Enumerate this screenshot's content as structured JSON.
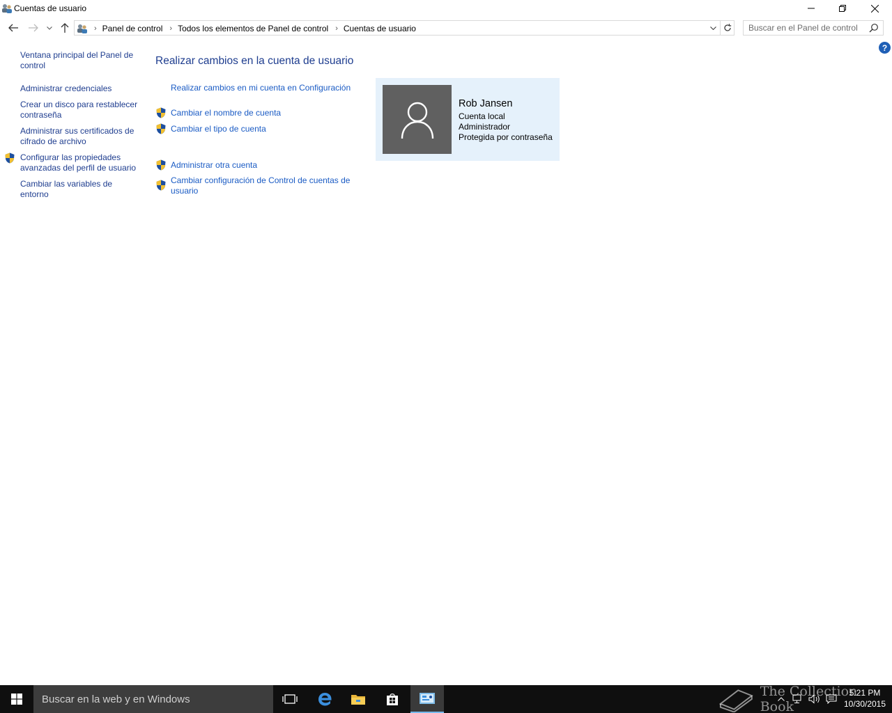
{
  "window": {
    "title": "Cuentas de usuario"
  },
  "breadcrumb": {
    "items": [
      "Panel de control",
      "Todos los elementos de Panel de control",
      "Cuentas de usuario"
    ]
  },
  "search": {
    "placeholder": "Buscar en el Panel de control"
  },
  "help": {
    "label": "?"
  },
  "left_pane": {
    "links": [
      "Ventana principal del Panel de control",
      "Administrar credenciales",
      "Crear un disco para restablecer contraseña",
      "Administrar sus certificados de cifrado de archivo",
      "Configurar las propiedades avanzadas del perfil de usuario",
      "Cambiar las variables de entorno"
    ]
  },
  "main": {
    "title": "Realizar cambios en la cuenta de usuario",
    "tasks": [
      "Realizar cambios en mi cuenta en Configuración",
      "Cambiar el nombre de cuenta",
      "Cambiar el tipo de cuenta",
      "Administrar otra cuenta",
      "Cambiar configuración de Control de cuentas de usuario"
    ]
  },
  "user": {
    "name": "Rob Jansen",
    "account_type": "Cuenta local",
    "role": "Administrador",
    "protection": "Protegida por contraseña"
  },
  "taskbar": {
    "search_placeholder": "Buscar en la web y en Windows",
    "watermark": "The Collection Book",
    "time": "5:21 PM",
    "date": "10/30/2015"
  },
  "colors": {
    "link": "#1e3d8f",
    "task_link": "#1a5bc4",
    "tile_bg": "#e5f1fb",
    "avatar_bg": "#606060",
    "taskbar": "#0f0f0f"
  }
}
